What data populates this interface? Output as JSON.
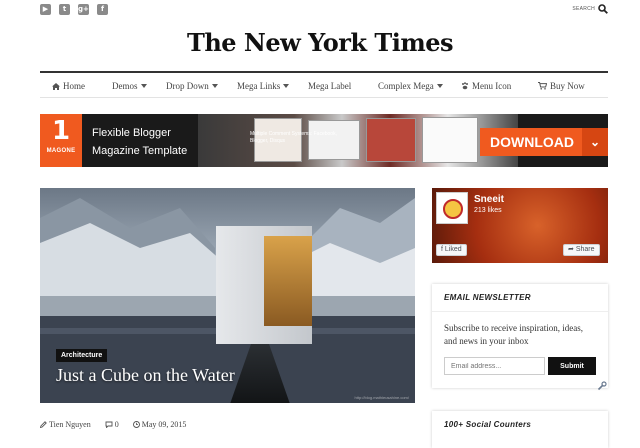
{
  "topbar": {
    "social_icons": [
      "youtube-icon",
      "twitter-icon",
      "google-plus-icon",
      "facebook-icon"
    ],
    "social_glyphs": [
      "▶",
      "t",
      "g+",
      "f"
    ],
    "search_label": "SEARCH"
  },
  "masthead": {
    "title": "The New York Times"
  },
  "nav": {
    "items": [
      {
        "label": "Home",
        "icon": "home-icon",
        "dropdown": false
      },
      {
        "label": "Demos",
        "dropdown": true
      },
      {
        "label": "Drop Down",
        "dropdown": true
      },
      {
        "label": "Mega Links",
        "dropdown": true
      },
      {
        "label": "Mega Label",
        "dropdown": false
      },
      {
        "label": "Complex Mega",
        "dropdown": true
      },
      {
        "label": "Menu Icon",
        "icon": "paw-icon",
        "dropdown": false
      },
      {
        "label": "Buy Now",
        "icon": "cart-icon",
        "dropdown": false
      }
    ]
  },
  "banner": {
    "logo_number": "1",
    "logo_brand": "MAGONE",
    "title_line1": "Flexible Blogger",
    "title_line2": "Magazine Template",
    "caption": "Multiple Comment Systems: Facebook, Blogger, Disqus",
    "download_label": "DOWNLOAD",
    "accent_color": "#f05a1f"
  },
  "hero": {
    "tag": "Architecture",
    "title": "Just a Cube on the Water",
    "credit": "http://blog.mathieusahine.com/"
  },
  "post_meta": {
    "author": "Tien Nguyen",
    "comments": "0",
    "date": "May 09, 2015"
  },
  "sidebar": {
    "facebook": {
      "page_name": "Sneeit",
      "likes": "213 likes",
      "liked_label": "Liked",
      "share_label": "Share"
    },
    "newsletter": {
      "title": "EMAIL NEWSLETTER",
      "description": "Subscribe to receive inspiration, ideas, and news in your inbox",
      "email_placeholder": "Email address...",
      "submit_label": "Submit"
    },
    "social_counters": {
      "title": "100+ Social Counters"
    }
  }
}
